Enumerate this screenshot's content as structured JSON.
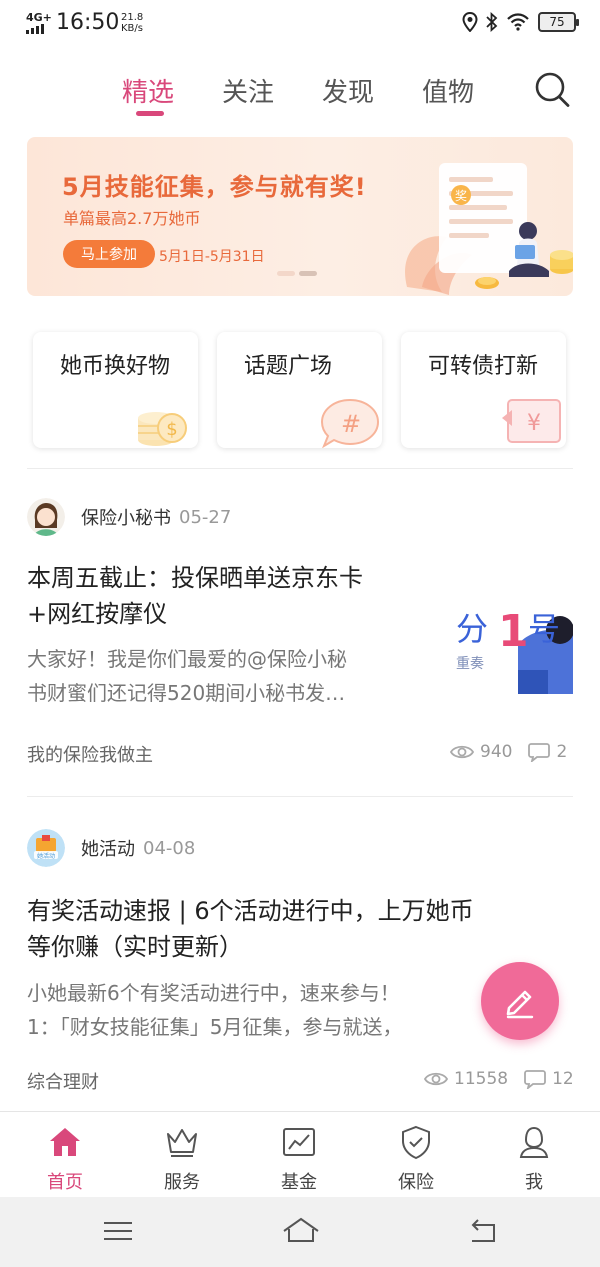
{
  "status_bar": {
    "network": "4G+",
    "time": "16:50",
    "speed_value": "21.8",
    "speed_unit": "KB/s",
    "battery": "75"
  },
  "tabs": [
    {
      "label": "精选",
      "active": true
    },
    {
      "label": "关注",
      "active": false
    },
    {
      "label": "发现",
      "active": false
    },
    {
      "label": "值物",
      "active": false
    }
  ],
  "banner": {
    "title": "5月技能征集，参与就有奖!",
    "subtitle": "单篇最高2.7万她币",
    "button_label": "马上参加",
    "date_range": "5月1日-5月31日",
    "badge": "奖",
    "slide_count": 2,
    "active_slide": 2
  },
  "shortcuts": [
    {
      "label": "她币换好物",
      "icon": "coins-icon"
    },
    {
      "label": "话题广场",
      "icon": "hashtag-bubble-icon"
    },
    {
      "label": "可转债打新",
      "icon": "yuan-exchange-icon"
    }
  ],
  "posts": [
    {
      "author": "保险小秘书",
      "date": "05-27",
      "title_lines": [
        "本周五截止：投保晒单送京东卡",
        "+网红按摩仪"
      ],
      "excerpt_lines": [
        "大家好！我是你们最爱的@保险小秘",
        "书财蜜们还记得520期间小秘书发…"
      ],
      "tag": "我的保险我做主",
      "views": "940",
      "comments": "2",
      "thumbnail": {
        "text_a": "分",
        "text_b": "1",
        "text_c": "号",
        "caption": "重奏"
      }
    },
    {
      "author": "她活动",
      "date": "04-08",
      "avatar_caption": "她活动",
      "title_lines": [
        "有奖活动速报 | 6个活动进行中，上万她币",
        "等你赚（实时更新）"
      ],
      "excerpt_lines": [
        "小她最新6个有奖活动进行中，速来参与！",
        "1：「财女技能征集」5月征集，参与就送，"
      ],
      "tag": "综合理财",
      "views": "11558",
      "comments": "12"
    }
  ],
  "bottom_nav": [
    {
      "label": "首页",
      "icon": "home-icon",
      "active": true
    },
    {
      "label": "服务",
      "icon": "crown-icon",
      "active": false
    },
    {
      "label": "基金",
      "icon": "chart-icon",
      "active": false
    },
    {
      "label": "保险",
      "icon": "shield-check-icon",
      "active": false
    },
    {
      "label": "我",
      "icon": "person-icon",
      "active": false
    }
  ],
  "colors": {
    "accent": "#d9487b",
    "banner_orange": "#e8693b",
    "fab": "#f06a98"
  }
}
